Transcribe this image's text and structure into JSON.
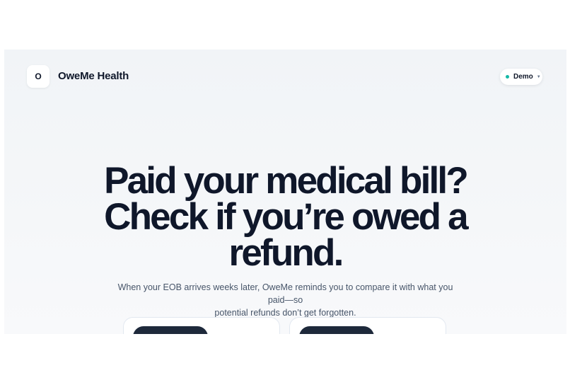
{
  "header": {
    "logo_letter": "O",
    "brand_name": "OweMe Health",
    "mode_label": "Demo"
  },
  "hero": {
    "headline_line1": "Paid your medical bill?",
    "headline_line2": "Check if you’re owed a",
    "headline_line3": "refund.",
    "subtext_line1": "When your EOB arrives weeks later, OweMe reminds you to compare it with what you paid—so",
    "subtext_line2": "potential refunds don’t get forgotten."
  },
  "colors": {
    "ink": "#0f172a",
    "muted": "#475569",
    "status_dot": "#14b8a6",
    "button": "#1e293b"
  },
  "icons": {
    "mode_status": "status-dot-icon",
    "mode_dropdown": "chevron-down-icon"
  }
}
